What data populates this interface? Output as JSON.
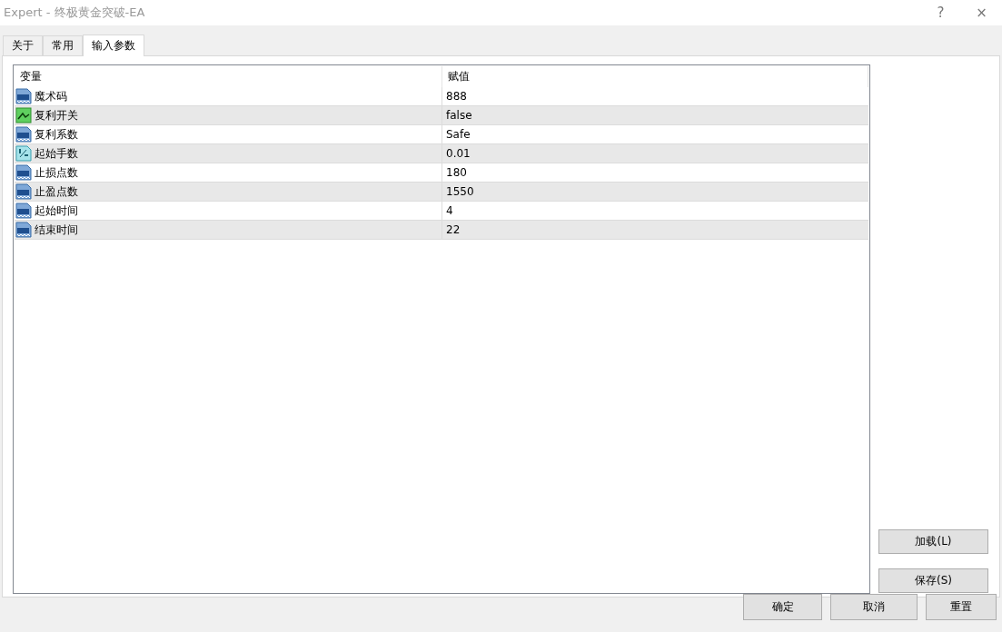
{
  "window": {
    "title": "Expert - 终极黄金突破-EA",
    "help": "?",
    "close": "×"
  },
  "tabs": [
    {
      "label": "关于",
      "selected": false
    },
    {
      "label": "常用",
      "selected": false
    },
    {
      "label": "输入参数",
      "selected": true
    }
  ],
  "table": {
    "columns": [
      "变量",
      "赋值"
    ],
    "rows": [
      {
        "kind": "int",
        "name": "魔术码",
        "value": "888"
      },
      {
        "kind": "bool",
        "name": "复利开关",
        "value": "false"
      },
      {
        "kind": "int",
        "name": "复利系数",
        "value": "Safe"
      },
      {
        "kind": "double",
        "name": "起始手数",
        "value": "0.01"
      },
      {
        "kind": "int",
        "name": "止损点数",
        "value": "180"
      },
      {
        "kind": "int",
        "name": "止盈点数",
        "value": "1550"
      },
      {
        "kind": "int",
        "name": "起始时间",
        "value": "4"
      },
      {
        "kind": "int",
        "name": "结束时间",
        "value": "22"
      }
    ]
  },
  "side_buttons": [
    "加载(L)",
    "保存(S)"
  ],
  "footer_buttons": [
    "确定",
    "取消",
    "重置"
  ]
}
